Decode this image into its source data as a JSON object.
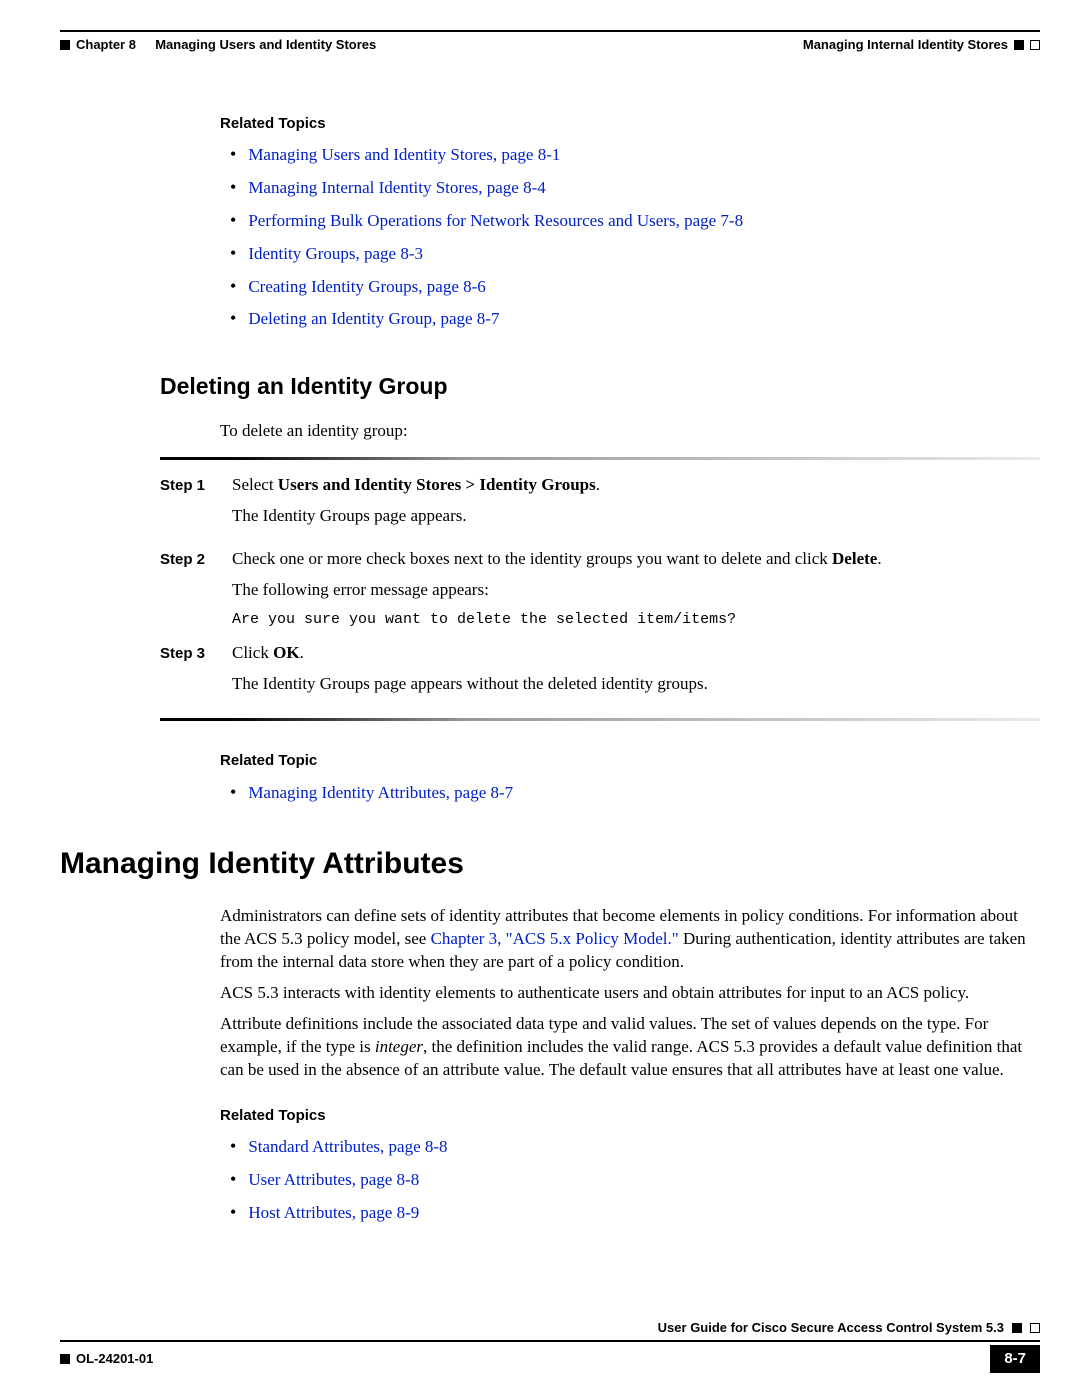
{
  "header": {
    "chapter_label": "Chapter 8",
    "chapter_title": "Managing Users and Identity Stores",
    "section_title": "Managing Internal Identity Stores"
  },
  "related1": {
    "heading": "Related Topics",
    "items": [
      "Managing Users and Identity Stores, page 8-1",
      "Managing Internal Identity Stores, page 8-4",
      "Performing Bulk Operations for Network Resources and Users, page 7-8",
      "Identity Groups, page 8-3",
      "Creating Identity Groups, page 8-6",
      "Deleting an Identity Group, page 8-7"
    ]
  },
  "delete_section": {
    "heading": "Deleting an Identity Group",
    "intro": "To delete an identity group:",
    "steps": {
      "label1": "Step 1",
      "s1_pre": "Select ",
      "s1_bold": "Users and Identity Stores > Identity Groups",
      "s1_post": ".",
      "s1_line2": "The Identity Groups page appears.",
      "label2": "Step 2",
      "s2_pre": "Check one or more check boxes next to the identity groups you want to delete and click ",
      "s2_bold": "Delete",
      "s2_post": ".",
      "s2_line2": "The following error message appears:",
      "s2_code": "Are you sure you want to delete the selected item/items?",
      "label3": "Step 3",
      "s3_pre": "Click ",
      "s3_bold": "OK",
      "s3_post": ".",
      "s3_line2": "The Identity Groups page appears without the deleted identity groups."
    }
  },
  "related2": {
    "heading": "Related Topic",
    "items": [
      "Managing Identity Attributes, page 8-7"
    ]
  },
  "attr_section": {
    "heading": "Managing Identity Attributes",
    "p1_pre": "Administrators can define sets of identity attributes that become elements in policy conditions. For information about the ACS 5.3 policy model, see ",
    "p1_link": "Chapter 3, \"ACS 5.x Policy Model.\"",
    "p1_post": " During authentication, identity attributes are taken from the internal data store when they are part of a policy condition.",
    "p2": "ACS 5.3 interacts with identity elements to authenticate users and obtain attributes for input to an ACS policy.",
    "p3_pre": "Attribute definitions include the associated data type and valid values. The set of values depends on the type. For example, if the type is ",
    "p3_it": "integer",
    "p3_post": ", the definition includes the valid range. ACS 5.3 provides a default value definition that can be used in the absence of an attribute value. The default value ensures that all attributes have at least one value."
  },
  "related3": {
    "heading": "Related Topics",
    "items": [
      "Standard Attributes, page 8-8",
      "User Attributes, page 8-8",
      "Host Attributes, page 8-9"
    ]
  },
  "footer": {
    "guide": "User Guide for Cisco Secure Access Control System 5.3",
    "docnum": "OL-24201-01",
    "pagenum": "8-7"
  }
}
